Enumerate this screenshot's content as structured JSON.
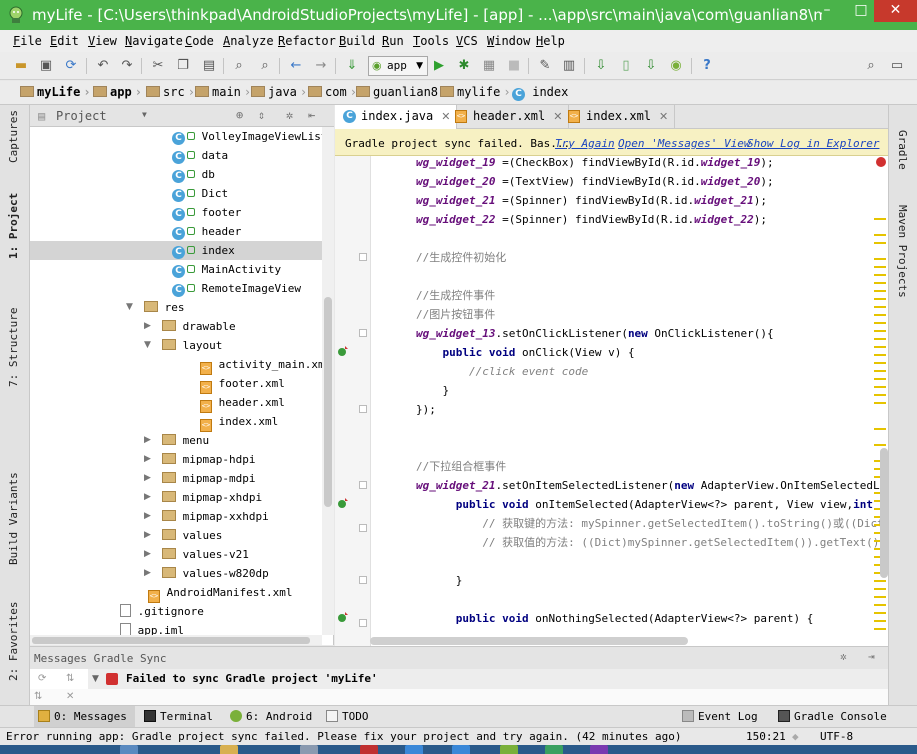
{
  "window": {
    "title": "myLife - [C:\\Users\\thinkpad\\AndroidStudioProjects\\myLife] - [app] - ...\\app\\src\\main\\java\\com\\guanlian8\\m...",
    "min": "–",
    "max": "□",
    "close": "✕"
  },
  "menu": [
    "File",
    "Edit",
    "View",
    "Navigate",
    "Code",
    "Analyze",
    "Refactor",
    "Build",
    "Run",
    "Tools",
    "VCS",
    "Window",
    "Help"
  ],
  "toolbar": {
    "run_config": "app",
    "icons": [
      "open-icon",
      "save-icon",
      "sync-icon",
      "undo-icon",
      "redo-icon",
      "cut-icon",
      "copy-icon",
      "paste-icon",
      "find-icon",
      "replace-icon",
      "back-icon",
      "forward-icon",
      "make-icon",
      "run-icon",
      "debug-icon",
      "coverage-icon",
      "stop-icon",
      "settings-icon",
      "project-structure-icon",
      "sdk-icon",
      "avd-icon",
      "monitor-icon",
      "help-icon",
      "search-everywhere-icon",
      "layout-icon"
    ]
  },
  "breadcrumbs": [
    "myLife",
    "app",
    "src",
    "main",
    "java",
    "com",
    "guanlian8",
    "mylife",
    "index"
  ],
  "left_tool_tabs": [
    "Captures",
    "1: Project",
    "7: Structure",
    "Build Variants",
    "2: Favorites"
  ],
  "right_tool_tabs": [
    "Gradle",
    "Maven Projects"
  ],
  "project": {
    "title": "Project",
    "tree": [
      {
        "label": "VolleyImageViewListAda",
        "icon": "class",
        "indent": 0
      },
      {
        "label": "data",
        "icon": "class",
        "indent": 0
      },
      {
        "label": "db",
        "icon": "class",
        "indent": 0
      },
      {
        "label": "Dict",
        "icon": "class",
        "indent": 0
      },
      {
        "label": "footer",
        "icon": "class",
        "indent": 0
      },
      {
        "label": "header",
        "icon": "class",
        "indent": 0
      },
      {
        "label": "index",
        "icon": "class",
        "indent": 0,
        "selected": true
      },
      {
        "label": "MainActivity",
        "icon": "class",
        "indent": 0
      },
      {
        "label": "RemoteImageView",
        "icon": "class",
        "indent": 0
      },
      {
        "label": "res",
        "icon": "folder",
        "indent": 1,
        "expanded": true
      },
      {
        "label": "drawable",
        "icon": "folder",
        "indent": 2
      },
      {
        "label": "layout",
        "icon": "folder",
        "indent": 2,
        "expanded": true
      },
      {
        "label": "activity_main.xml",
        "icon": "xml",
        "indent": 3
      },
      {
        "label": "footer.xml",
        "icon": "xml",
        "indent": 3
      },
      {
        "label": "header.xml",
        "icon": "xml",
        "indent": 3
      },
      {
        "label": "index.xml",
        "icon": "xml",
        "indent": 3
      },
      {
        "label": "menu",
        "icon": "folder",
        "indent": 2
      },
      {
        "label": "mipmap-hdpi",
        "icon": "folder",
        "indent": 2
      },
      {
        "label": "mipmap-mdpi",
        "icon": "folder",
        "indent": 2
      },
      {
        "label": "mipmap-xhdpi",
        "icon": "folder",
        "indent": 2
      },
      {
        "label": "mipmap-xxhdpi",
        "icon": "folder",
        "indent": 2
      },
      {
        "label": "values",
        "icon": "folder",
        "indent": 2
      },
      {
        "label": "values-v21",
        "icon": "folder",
        "indent": 2
      },
      {
        "label": "values-w820dp",
        "icon": "folder",
        "indent": 2
      },
      {
        "label": "AndroidManifest.xml",
        "icon": "xml",
        "indent": 4
      },
      {
        "label": ".gitignore",
        "icon": "file",
        "indent": 5
      },
      {
        "label": "app.iml",
        "icon": "file",
        "indent": 5
      }
    ]
  },
  "editor_tabs": [
    {
      "label": "index.java",
      "active": true
    },
    {
      "label": "header.xml",
      "active": false
    },
    {
      "label": "index.xml",
      "active": false
    }
  ],
  "banner": {
    "text": "Gradle project sync failed. Bas...",
    "links": [
      "Try Again",
      "Open 'Messages' View",
      "Show Log in Explorer"
    ]
  },
  "code_lines": [
    [
      [
        "fld2",
        "wg_widget_19"
      ],
      [
        "t",
        " =(CheckBox) findViewById(R.id."
      ],
      [
        "fld2",
        "widget_19"
      ],
      [
        "t",
        ");"
      ]
    ],
    [
      [
        "fld2",
        "wg_widget_20"
      ],
      [
        "t",
        " =(TextView) findViewById(R.id."
      ],
      [
        "fld2",
        "widget_20"
      ],
      [
        "t",
        ");"
      ]
    ],
    [
      [
        "fld2",
        "wg_widget_21"
      ],
      [
        "t",
        " =(Spinner) findViewById(R.id."
      ],
      [
        "fld2",
        "widget_21"
      ],
      [
        "t",
        ");"
      ]
    ],
    [
      [
        "fld2",
        "wg_widget_22"
      ],
      [
        "t",
        " =(Spinner) findViewById(R.id."
      ],
      [
        "fld2",
        "widget_22"
      ],
      [
        "t",
        ");"
      ]
    ],
    [],
    [
      [
        "cmtcn",
        "//生成控件初始化"
      ]
    ],
    [],
    [
      [
        "cmtcn",
        "//生成控件事件"
      ]
    ],
    [
      [
        "cmtcn",
        "//图片按钮事件"
      ]
    ],
    [
      [
        "fld2",
        "wg_widget_13"
      ],
      [
        "t",
        ".setOnClickListener("
      ],
      [
        "kw",
        "new"
      ],
      [
        "t",
        " OnClickListener(){"
      ]
    ],
    [
      [
        "t",
        "    "
      ],
      [
        "kw",
        "public void"
      ],
      [
        "t",
        " onClick(View v) {"
      ]
    ],
    [
      [
        "t",
        "        "
      ],
      [
        "cmt",
        "//click event code"
      ]
    ],
    [
      [
        "t",
        "    }"
      ]
    ],
    [
      [
        "t",
        "});"
      ]
    ],
    [],
    [],
    [
      [
        "cmtcn",
        "//下拉组合框事件"
      ]
    ],
    [
      [
        "fld2",
        "wg_widget_21"
      ],
      [
        "t",
        ".setOnItemSelectedListener("
      ],
      [
        "kw",
        "new"
      ],
      [
        "t",
        " AdapterView.OnItemSelectedListene"
      ]
    ],
    [
      [
        "t",
        "      "
      ],
      [
        "kw",
        "public void"
      ],
      [
        "t",
        " onItemSelected(AdapterView<?> parent, View view,"
      ],
      [
        "kw",
        "int"
      ],
      [
        "t",
        " positi"
      ]
    ],
    [
      [
        "t",
        "          "
      ],
      [
        "cmtcn",
        "// 获取键的方法: mySpinner.getSelectedItem().toString()或((Dict)mySp"
      ]
    ],
    [
      [
        "t",
        "          "
      ],
      [
        "cmtcn",
        "// 获取值的方法: ((Dict)mySpinner.getSelectedItem()).getText();"
      ]
    ],
    [],
    [
      [
        "t",
        "      }"
      ]
    ],
    [],
    [
      [
        "t",
        "      "
      ],
      [
        "kw",
        "public void"
      ],
      [
        "t",
        " onNothingSelected(AdapterView<?> parent) {"
      ]
    ]
  ],
  "messages": {
    "header": "Messages Gradle Sync",
    "row": "Failed to sync Gradle project 'myLife'"
  },
  "bottom_tabs": [
    {
      "label": "0: Messages",
      "active": true
    },
    {
      "label": "Terminal"
    },
    {
      "label": "6: Android"
    },
    {
      "label": "TODO"
    },
    {
      "label": "Event Log"
    },
    {
      "label": "Gradle Console"
    }
  ],
  "status": {
    "text": "Error running app: Gradle project sync failed. Please fix your project and try again. (42 minutes ago)",
    "position": "150:21",
    "encoding": "UTF-8"
  },
  "colors": {
    "title_bar": "#4ab34a",
    "banner": "#f7f1c3",
    "keyword": "#000080",
    "field": "#660e7a",
    "comment": "#808080",
    "link": "#1a44c0"
  }
}
